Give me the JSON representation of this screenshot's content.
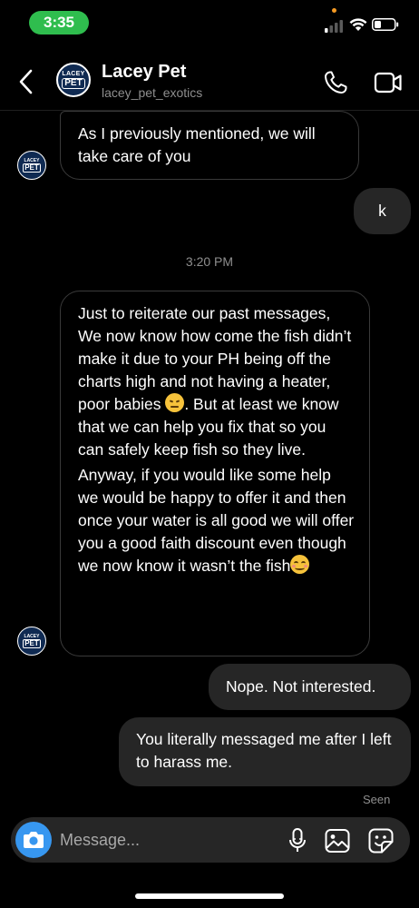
{
  "status_bar": {
    "time": "3:35"
  },
  "header": {
    "avatar_text_top": "LACEY",
    "avatar_text_mid": "PET",
    "contact_name": "Lacey Pet",
    "contact_handle": "lacey_pet_exotics",
    "back_icon": "chevron-left-icon",
    "call_icon": "phone-icon",
    "video_icon": "video-camera-icon"
  },
  "messages": {
    "msg1": "As I previously mentioned, we will take care of you",
    "msg2": "k",
    "timestamp": "3:20 PM",
    "msg3_para1_before_emoji": "Just to reiterate our past messages, We now know how come the fish didn’t make it due to your PH being off the charts high and not having a heater, poor babies ",
    "msg3_para1_after_emoji": ". But at least we know that we can help you fix that so you can safely keep fish so they live.",
    "msg3_para2": "Anyway, if you would like some help we would be happy to offer it and then once your water is all good we will offer you a good faith discount even though we now know it wasn’t the fish",
    "msg4": "Nope. Not interested.",
    "msg5": "You literally messaged me after I left to harass me.",
    "seen": "Seen"
  },
  "composer": {
    "placeholder": "Message...",
    "camera_icon": "camera-icon",
    "mic_icon": "microphone-icon",
    "gallery_icon": "image-icon",
    "sticker_icon": "sticker-icon"
  },
  "colors": {
    "background": "#000000",
    "incoming_border": "#3a3a3a",
    "outgoing_bubble": "#262626",
    "accent": "#3797f0",
    "time_pill": "#2fbd4e"
  }
}
